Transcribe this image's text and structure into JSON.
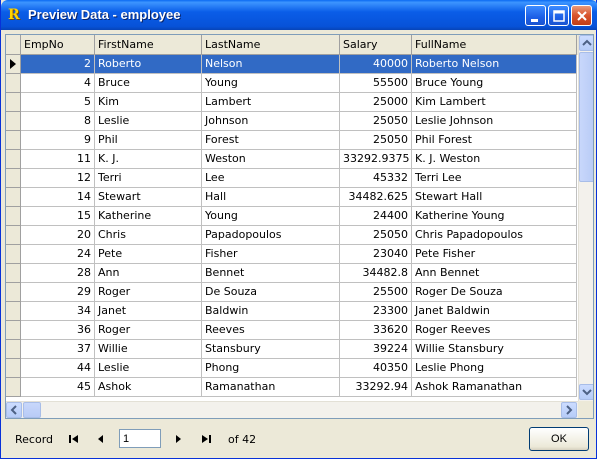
{
  "window": {
    "title": "Preview Data - employee",
    "icon": "R"
  },
  "grid": {
    "columns": [
      {
        "label": "EmpNo",
        "width": 74,
        "numeric": true
      },
      {
        "label": "FirstName",
        "width": 107,
        "numeric": false
      },
      {
        "label": "LastName",
        "width": 138,
        "numeric": false
      },
      {
        "label": "Salary",
        "width": 72,
        "numeric": true
      },
      {
        "label": "FullName",
        "width": 165,
        "numeric": false
      }
    ],
    "selected_row": 0,
    "rows": [
      [
        "2",
        "Roberto",
        "Nelson",
        "40000",
        "Roberto Nelson"
      ],
      [
        "4",
        "Bruce",
        "Young",
        "55500",
        "Bruce Young"
      ],
      [
        "5",
        "Kim",
        "Lambert",
        "25000",
        "Kim Lambert"
      ],
      [
        "8",
        "Leslie",
        "Johnson",
        "25050",
        "Leslie Johnson"
      ],
      [
        "9",
        "Phil",
        "Forest",
        "25050",
        "Phil Forest"
      ],
      [
        "11",
        "K. J.",
        "Weston",
        "33292.9375",
        "K. J. Weston"
      ],
      [
        "12",
        "Terri",
        "Lee",
        "45332",
        "Terri Lee"
      ],
      [
        "14",
        "Stewart",
        "Hall",
        "34482.625",
        "Stewart Hall"
      ],
      [
        "15",
        "Katherine",
        "Young",
        "24400",
        "Katherine Young"
      ],
      [
        "20",
        "Chris",
        "Papadopoulos",
        "25050",
        "Chris Papadopoulos"
      ],
      [
        "24",
        "Pete",
        "Fisher",
        "23040",
        "Pete Fisher"
      ],
      [
        "28",
        "Ann",
        "Bennet",
        "34482.8",
        "Ann Bennet"
      ],
      [
        "29",
        "Roger",
        "De Souza",
        "25500",
        "Roger De Souza"
      ],
      [
        "34",
        "Janet",
        "Baldwin",
        "23300",
        "Janet Baldwin"
      ],
      [
        "36",
        "Roger",
        "Reeves",
        "33620",
        "Roger Reeves"
      ],
      [
        "37",
        "Willie",
        "Stansbury",
        "39224",
        "Willie Stansbury"
      ],
      [
        "44",
        "Leslie",
        "Phong",
        "40350",
        "Leslie Phong"
      ],
      [
        "45",
        "Ashok",
        "Ramanathan",
        "33292.94",
        "Ashok Ramanathan"
      ]
    ]
  },
  "footer": {
    "record_label": "Record",
    "record_value": "1",
    "of_label": "of 42",
    "ok_label": "OK"
  },
  "colors": {
    "selection": "#316ac5",
    "titlebar": "#0a5de8",
    "face": "#ece9d8"
  }
}
